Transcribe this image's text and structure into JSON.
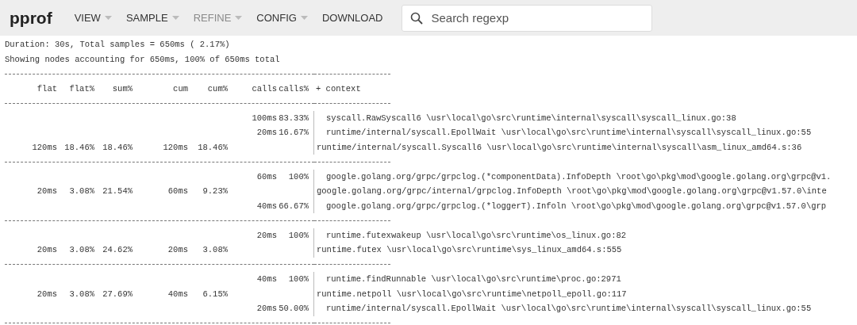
{
  "toolbar": {
    "logo": "pprof",
    "menu": [
      {
        "label": "VIEW",
        "dropdown": true,
        "disabled": false
      },
      {
        "label": "SAMPLE",
        "dropdown": true,
        "disabled": false
      },
      {
        "label": "REFINE",
        "dropdown": true,
        "disabled": true
      },
      {
        "label": "CONFIG",
        "dropdown": true,
        "disabled": false
      },
      {
        "label": "DOWNLOAD",
        "dropdown": false,
        "disabled": false
      }
    ],
    "search": {
      "placeholder": "Search regexp"
    }
  },
  "summary": [
    "Duration: 30s, Total samples = 650ms ( 2.17%)",
    "Showing nodes accounting for 650ms, 100% of 650ms total"
  ],
  "table": {
    "columns": [
      "flat",
      "flat%",
      "sum%",
      "cum",
      "cum%",
      "calls",
      "calls%",
      "+ context"
    ],
    "groups": [
      {
        "rows": [
          {
            "kind": "caller",
            "calls": "100ms",
            "calls_pct": "83.33%",
            "context": "syscall.RawSyscall6 \\usr\\local\\go\\src\\runtime\\internal\\syscall\\syscall_linux.go:38"
          },
          {
            "kind": "caller",
            "calls": "20ms",
            "calls_pct": "16.67%",
            "context": "runtime/internal/syscall.EpollWait \\usr\\local\\go\\src\\runtime\\internal\\syscall\\syscall_linux.go:55"
          },
          {
            "kind": "node",
            "flat": "120ms",
            "flat_pct": "18.46%",
            "sum_pct": "18.46%",
            "cum": "120ms",
            "cum_pct": "18.46%",
            "context": "runtime/internal/syscall.Syscall6 \\usr\\local\\go\\src\\runtime\\internal\\syscall\\asm_linux_amd64.s:36"
          }
        ]
      },
      {
        "rows": [
          {
            "kind": "caller",
            "calls": "60ms",
            "calls_pct": "100%",
            "context": "google.golang.org/grpc/grpclog.(*componentData).InfoDepth \\root\\go\\pkg\\mod\\google.golang.org\\grpc@v1."
          },
          {
            "kind": "node",
            "flat": "20ms",
            "flat_pct": "3.08%",
            "sum_pct": "21.54%",
            "cum": "60ms",
            "cum_pct": "9.23%",
            "context": "google.golang.org/grpc/internal/grpclog.InfoDepth \\root\\go\\pkg\\mod\\google.golang.org\\grpc@v1.57.0\\inte"
          },
          {
            "kind": "callee",
            "calls": "40ms",
            "calls_pct": "66.67%",
            "context": "google.golang.org/grpc/grpclog.(*loggerT).Infoln \\root\\go\\pkg\\mod\\google.golang.org\\grpc@v1.57.0\\grp"
          }
        ]
      },
      {
        "rows": [
          {
            "kind": "caller",
            "calls": "20ms",
            "calls_pct": "100%",
            "context": "runtime.futexwakeup \\usr\\local\\go\\src\\runtime\\os_linux.go:82"
          },
          {
            "kind": "node",
            "flat": "20ms",
            "flat_pct": "3.08%",
            "sum_pct": "24.62%",
            "cum": "20ms",
            "cum_pct": "3.08%",
            "context": "runtime.futex \\usr\\local\\go\\src\\runtime\\sys_linux_amd64.s:555"
          }
        ]
      },
      {
        "rows": [
          {
            "kind": "caller",
            "calls": "40ms",
            "calls_pct": "100%",
            "context": "runtime.findRunnable \\usr\\local\\go\\src\\runtime\\proc.go:2971"
          },
          {
            "kind": "node",
            "flat": "20ms",
            "flat_pct": "3.08%",
            "sum_pct": "27.69%",
            "cum": "40ms",
            "cum_pct": "6.15%",
            "context": "runtime.netpoll \\usr\\local\\go\\src\\runtime\\netpoll_epoll.go:117"
          },
          {
            "kind": "callee",
            "calls": "20ms",
            "calls_pct": "50.00%",
            "context": "runtime/internal/syscall.EpollWait \\usr\\local\\go\\src\\runtime\\internal\\syscall\\syscall_linux.go:55"
          }
        ]
      }
    ]
  }
}
